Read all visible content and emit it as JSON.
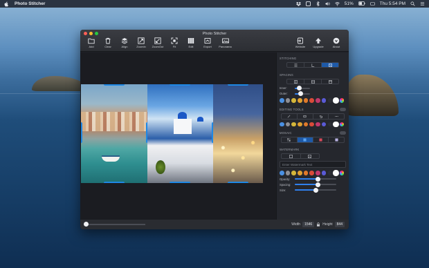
{
  "menubar": {
    "app_name": "Photo Stitcher",
    "battery": "51%",
    "clock": "Thu 5:54 PM"
  },
  "window": {
    "title": "Photo Stitcher"
  },
  "toolbar": {
    "left": [
      {
        "label": "Add",
        "icon": "folder-icon"
      },
      {
        "label": "Clear",
        "icon": "trash-icon"
      },
      {
        "label": "Align",
        "icon": "layers-icon"
      },
      {
        "label": "ZoomIn",
        "icon": "zoom-in-icon"
      },
      {
        "label": "ZoomOut",
        "icon": "zoom-out-icon"
      },
      {
        "label": "Fit",
        "icon": "fit-icon"
      },
      {
        "label": "Edit",
        "icon": "edit-columns-icon"
      },
      {
        "label": "Export",
        "icon": "export-icon"
      },
      {
        "label": "Panorama",
        "icon": "panorama-icon"
      }
    ],
    "right": [
      {
        "label": "Website",
        "icon": "website-icon"
      },
      {
        "label": "Upgrade",
        "icon": "upgrade-icon"
      },
      {
        "label": "About",
        "icon": "about-icon"
      }
    ]
  },
  "statusbar": {
    "width_label": "Width",
    "width_value": "1546",
    "height_label": "Height",
    "height_value": "844"
  },
  "panel": {
    "stitching": {
      "label": "STITCHING",
      "active_index": 2
    },
    "spacing": {
      "label": "SPACING",
      "inner_label": "Inner:",
      "outer_label": "Outer:",
      "inner_value": 0.3,
      "outer_value": 0.4
    },
    "editing": {
      "label": "EDITING TOOLS"
    },
    "mosaic": {
      "label": "MOSAIC"
    },
    "watermark": {
      "label": "WATERMARK",
      "placeholder": "Enter Watermark Text",
      "opacity_label": "Opacity:",
      "spacing_label": "Spacing:",
      "size_label": "Size:",
      "opacity_value": 0.55,
      "spacing_value": 0.55,
      "size_value": 0.5
    },
    "swatch_colors": [
      "#4a90e2",
      "#8e8e93",
      "#d4b63a",
      "#e0a030",
      "#e07a2a",
      "#d94b3a",
      "#c0396b",
      "#5a5ad6",
      "#2d2f36",
      "#ffffff",
      "#e25fbf"
    ]
  }
}
